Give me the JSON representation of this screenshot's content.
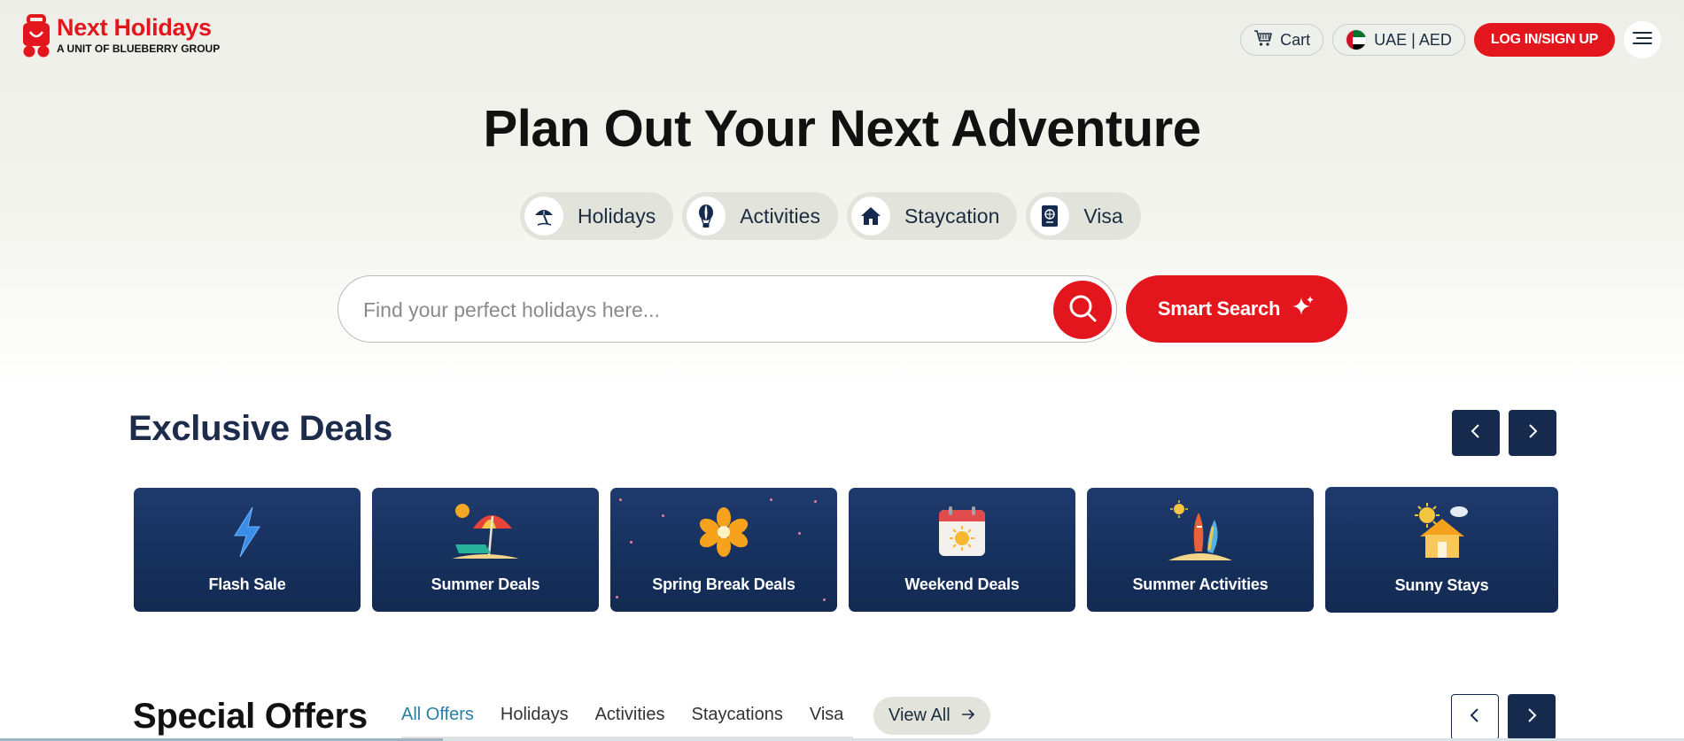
{
  "brand": {
    "name": "Next Holidays",
    "tagline": "A UNIT OF BLUEBERRY GROUP",
    "red": "#e4161d",
    "navy": "#152a4d"
  },
  "header": {
    "cart_label": "Cart",
    "region_label": "UAE | AED",
    "login_label": "LOG IN/SIGN UP",
    "menu_icon": "hamburger-icon"
  },
  "hero": {
    "title": "Plan Out Your Next Adventure",
    "categories": [
      {
        "label": "Holidays",
        "icon": "beach-umbrella-icon"
      },
      {
        "label": "Activities",
        "icon": "hot-air-balloon-icon"
      },
      {
        "label": "Staycation",
        "icon": "house-icon"
      },
      {
        "label": "Visa",
        "icon": "passport-icon"
      }
    ],
    "search_placeholder": "Find your perfect holidays here...",
    "smart_search_label": "Smart Search"
  },
  "exclusive_deals": {
    "title": "Exclusive Deals",
    "items": [
      {
        "label": "Flash Sale",
        "icon": "lightning-icon"
      },
      {
        "label": "Summer Deals",
        "icon": "beach-chair-umbrella-icon"
      },
      {
        "label": "Spring Break Deals",
        "icon": "flower-icon"
      },
      {
        "label": "Weekend Deals",
        "icon": "calendar-sun-icon"
      },
      {
        "label": "Summer Activities",
        "icon": "surfboards-icon"
      },
      {
        "label": "Sunny Stays",
        "icon": "sunny-house-icon"
      }
    ]
  },
  "special_offers": {
    "title": "Special Offers",
    "tabs": [
      "All Offers",
      "Holidays",
      "Activities",
      "Staycations",
      "Visa"
    ],
    "active_tab": "All Offers",
    "view_all_label": "View All"
  }
}
